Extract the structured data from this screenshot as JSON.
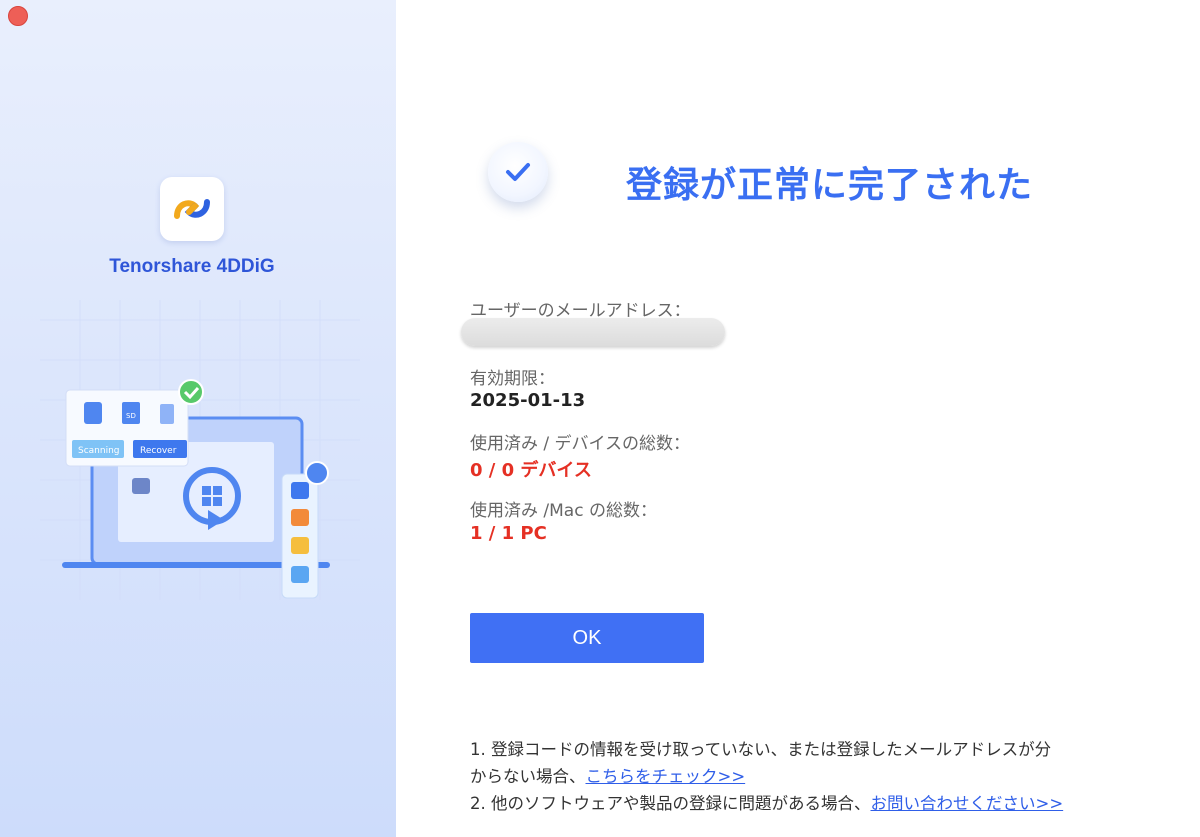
{
  "brand": {
    "name": "Tenorshare 4DDiG"
  },
  "illustration": {
    "scanning_label": "Scanning",
    "recover_label": "Recover",
    "card_badge": "SD"
  },
  "result": {
    "title": "登録が正常に完了された",
    "email_label": "ユーザーのメールアドレス：",
    "email_value": "",
    "expiry_label": "有効期限：",
    "expiry_value": "2025-01-13",
    "devices_label": "使用済み / デバイスの総数：",
    "devices_value": "0 / 0 デバイス",
    "mac_label": "使用済み /Mac の総数：",
    "mac_value": "1 / 1 PC",
    "ok_label": "OK"
  },
  "notes": {
    "line1_text": "1. 登録コードの情報を受け取っていない、または登録したメールアドレスが分",
    "line2_text": "からない場合、",
    "line2_link": "こちらをチェック>>",
    "line3_text": "2. 他のソフトウェアや製品の登録に問題がある場合、",
    "line3_link": "お問い合わせください>>"
  },
  "colors": {
    "accent": "#4070f4",
    "title_blue": "#3a6ff2",
    "red_value": "#e53024",
    "link": "#2f5ee8",
    "close": "#ee5f57"
  }
}
